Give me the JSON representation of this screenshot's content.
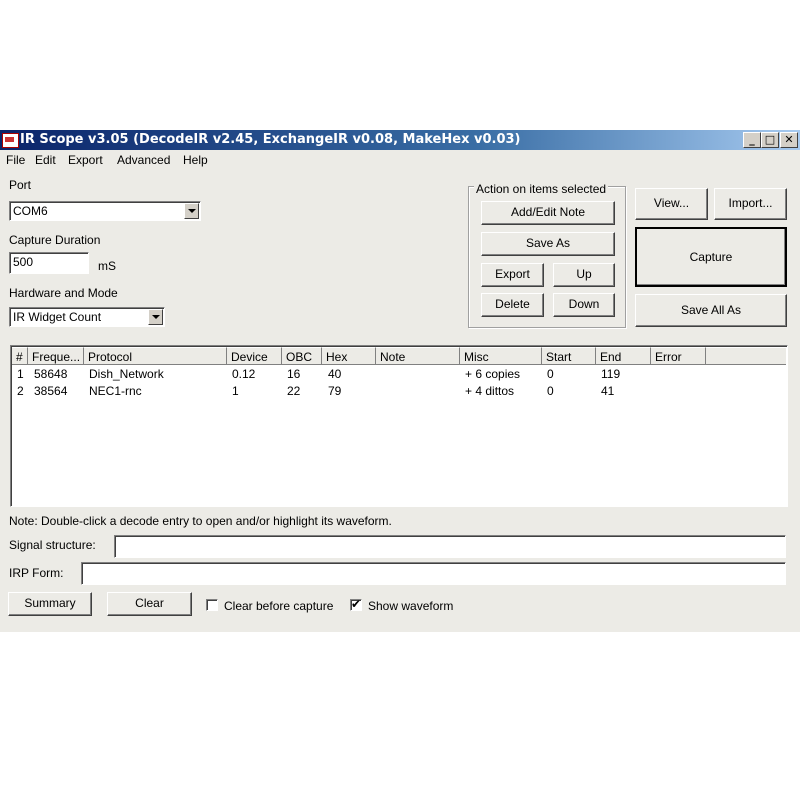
{
  "window": {
    "title": "IR Scope v3.05 (DecodeIR v2.45, ExchangeIR v0.08, MakeHex v0.03)",
    "controls": [
      "_",
      "□",
      "✕"
    ]
  },
  "menu": [
    "File",
    "Edit",
    "Export",
    "Advanced",
    "Help"
  ],
  "port": {
    "label": "Port",
    "value": "COM6"
  },
  "capture_duration": {
    "label": "Capture Duration",
    "value": "500",
    "unit": "mS"
  },
  "hardware": {
    "label": "Hardware and Mode",
    "value": "IR Widget Count"
  },
  "actions_group": {
    "legend": "Action on items selected",
    "add_edit_note": "Add/Edit Note",
    "save_as": "Save As",
    "export": "Export",
    "up": "Up",
    "delete": "Delete",
    "down": "Down"
  },
  "right_buttons": {
    "view": "View...",
    "import": "Import...",
    "capture": "Capture",
    "save_all_as": "Save All As"
  },
  "table": {
    "columns": [
      "#",
      "Freque...",
      "Protocol",
      "Device",
      "OBC",
      "Hex",
      "Note",
      "Misc",
      "Start",
      "End",
      "Error"
    ],
    "rows": [
      [
        "1",
        "58648",
        "Dish_Network",
        "0.12",
        "16",
        "40",
        "",
        "+ 6 copies",
        "0",
        "119",
        ""
      ],
      [
        "2",
        "38564",
        "NEC1-rnc",
        "1",
        "22",
        "79",
        "",
        "+ 4 dittos",
        "0",
        "41",
        ""
      ]
    ]
  },
  "note": "Note:  Double-click a decode entry to open and/or highlight its waveform.",
  "signal_structure": {
    "label": "Signal structure:",
    "value": ""
  },
  "irp_form": {
    "label": "IRP Form:",
    "value": ""
  },
  "bottom": {
    "summary": "Summary",
    "clear": "Clear",
    "clear_before_capture": "Clear before capture",
    "show_waveform": "Show waveform",
    "clear_before_capture_checked": false,
    "show_waveform_checked": true
  }
}
